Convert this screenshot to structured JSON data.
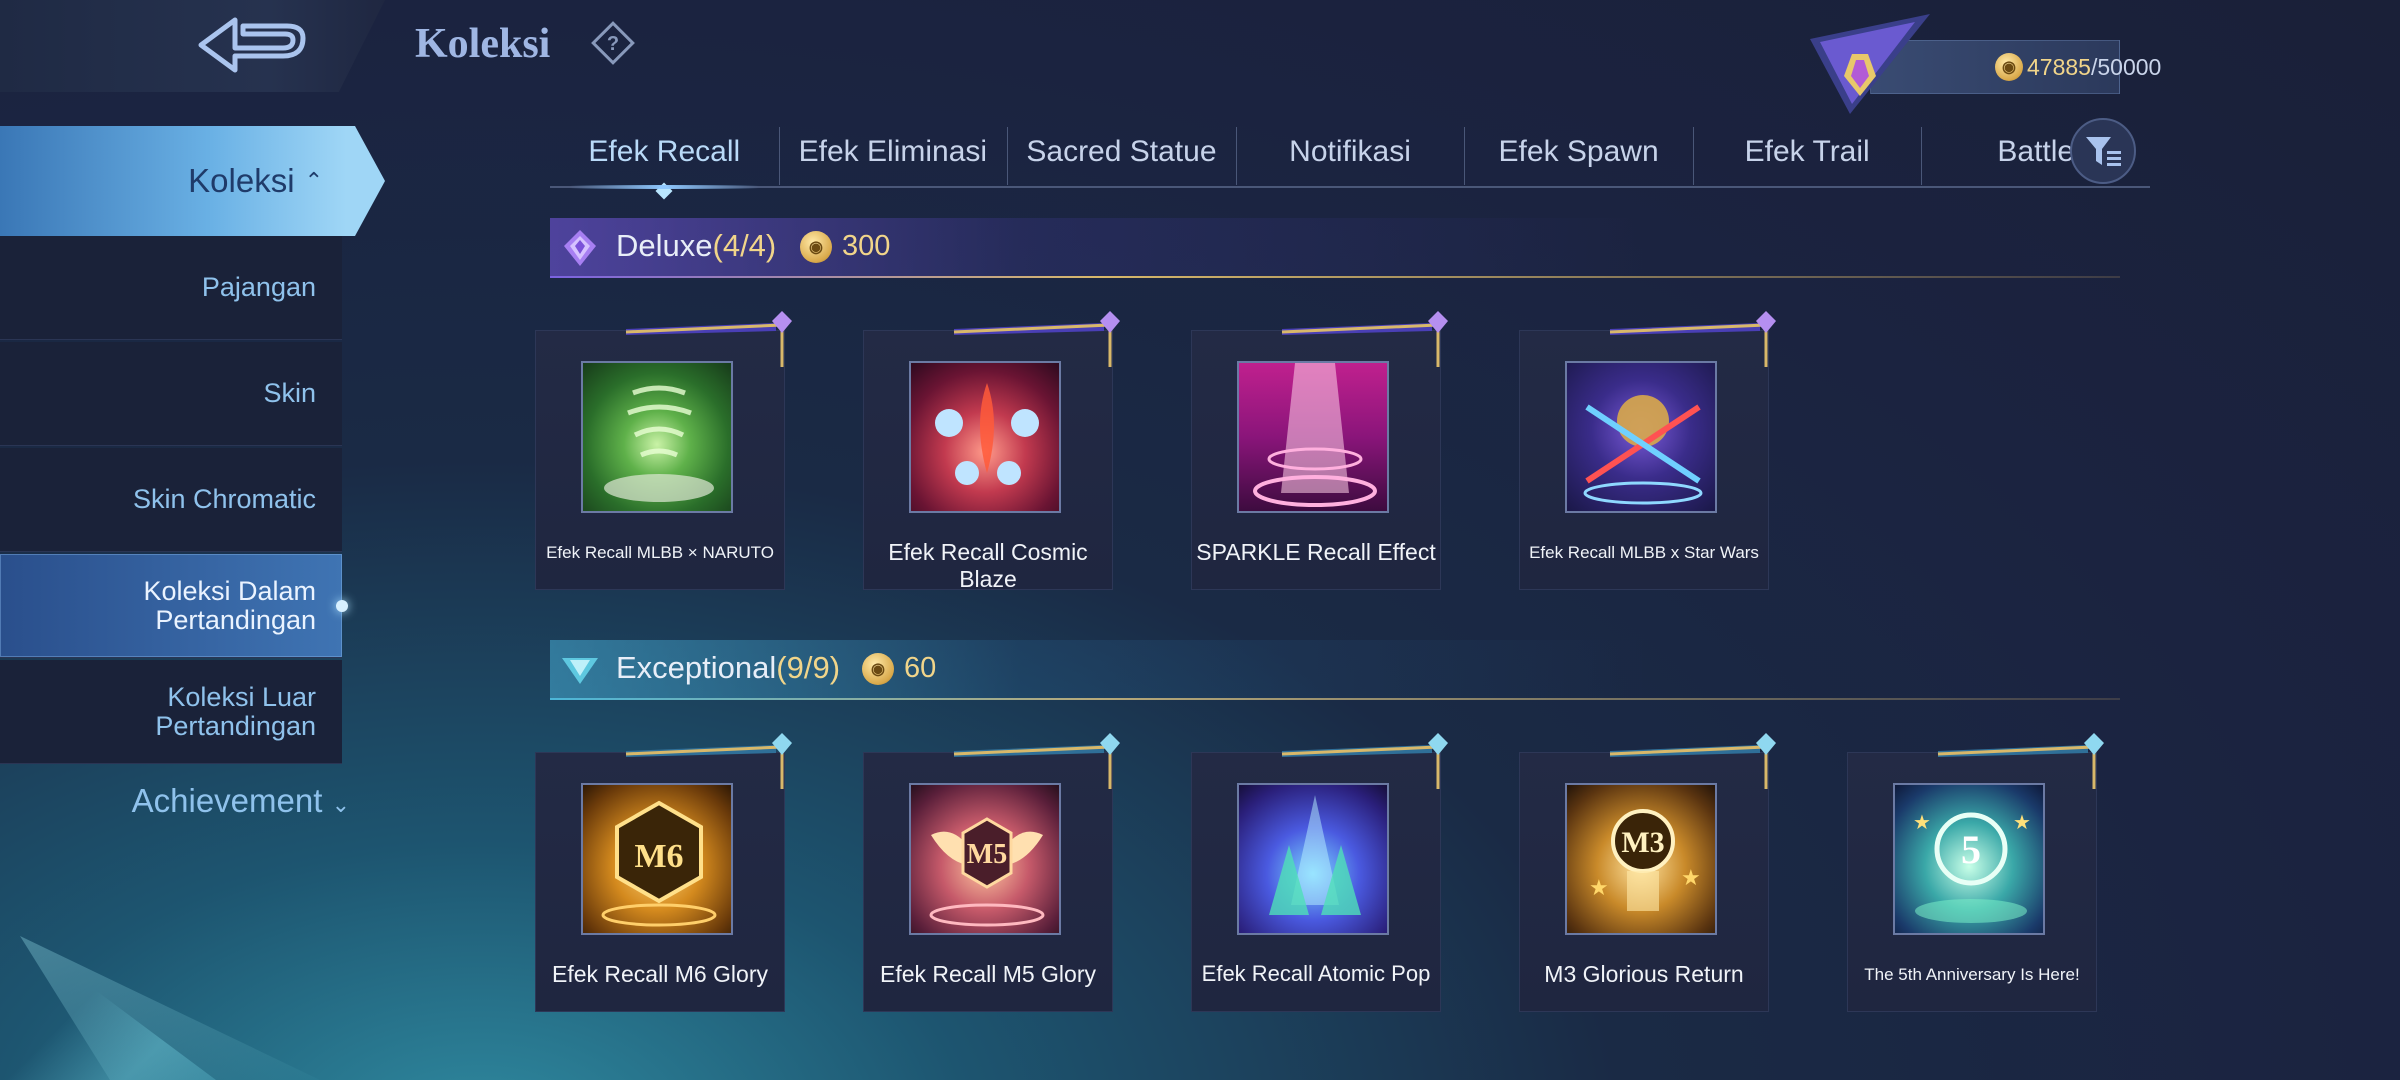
{
  "header": {
    "title": "Koleksi",
    "currency_value": "47885",
    "currency_max": "/50000"
  },
  "sidebar": {
    "main_label": "Koleksi",
    "items": [
      {
        "label": "Pajangan"
      },
      {
        "label": "Skin"
      },
      {
        "label": "Skin Chromatic"
      },
      {
        "label": "Koleksi Dalam Pertandingan",
        "active": true
      },
      {
        "label": "Koleksi Luar Pertandingan"
      }
    ],
    "achievement_label": "Achievement"
  },
  "tabs": [
    {
      "label": "Efek Recall",
      "active": true
    },
    {
      "label": "Efek Eliminasi"
    },
    {
      "label": "Sacred Statue"
    },
    {
      "label": "Notifikasi"
    },
    {
      "label": "Efek Spawn"
    },
    {
      "label": "Efek Trail"
    },
    {
      "label": "Battle"
    }
  ],
  "sections": {
    "deluxe": {
      "title": "Deluxe",
      "count": "(4/4)",
      "price": "300",
      "accent": "#7a62e0",
      "items": [
        {
          "name": "Efek Recall MLBB × NARUTO",
          "icon": "naruto-tornado-icon"
        },
        {
          "name": "Efek Recall Cosmic Blaze",
          "icon": "cosmic-blaze-icon"
        },
        {
          "name": "SPARKLE Recall Effect",
          "icon": "sparkle-beam-icon"
        },
        {
          "name": "Efek Recall MLBB x Star Wars",
          "icon": "star-wars-sabers-icon"
        }
      ]
    },
    "exceptional": {
      "title": "Exceptional",
      "count": "(9/9)",
      "price": "60",
      "accent": "#4cb6d8",
      "items": [
        {
          "name": "Efek Recall M6 Glory",
          "icon": "m6-emblem-icon"
        },
        {
          "name": "Efek Recall M5 Glory",
          "icon": "m5-emblem-icon"
        },
        {
          "name": "Efek Recall Atomic Pop",
          "icon": "atomic-pop-icon"
        },
        {
          "name": "M3 Glorious Return",
          "icon": "m3-emblem-icon"
        },
        {
          "name": "The 5th Anniversary Is Here!",
          "icon": "5th-anniversary-icon"
        }
      ]
    }
  },
  "icon_labels": {
    "m6": "M6",
    "m5": "M5",
    "m3": "M3",
    "anniv": "5"
  }
}
